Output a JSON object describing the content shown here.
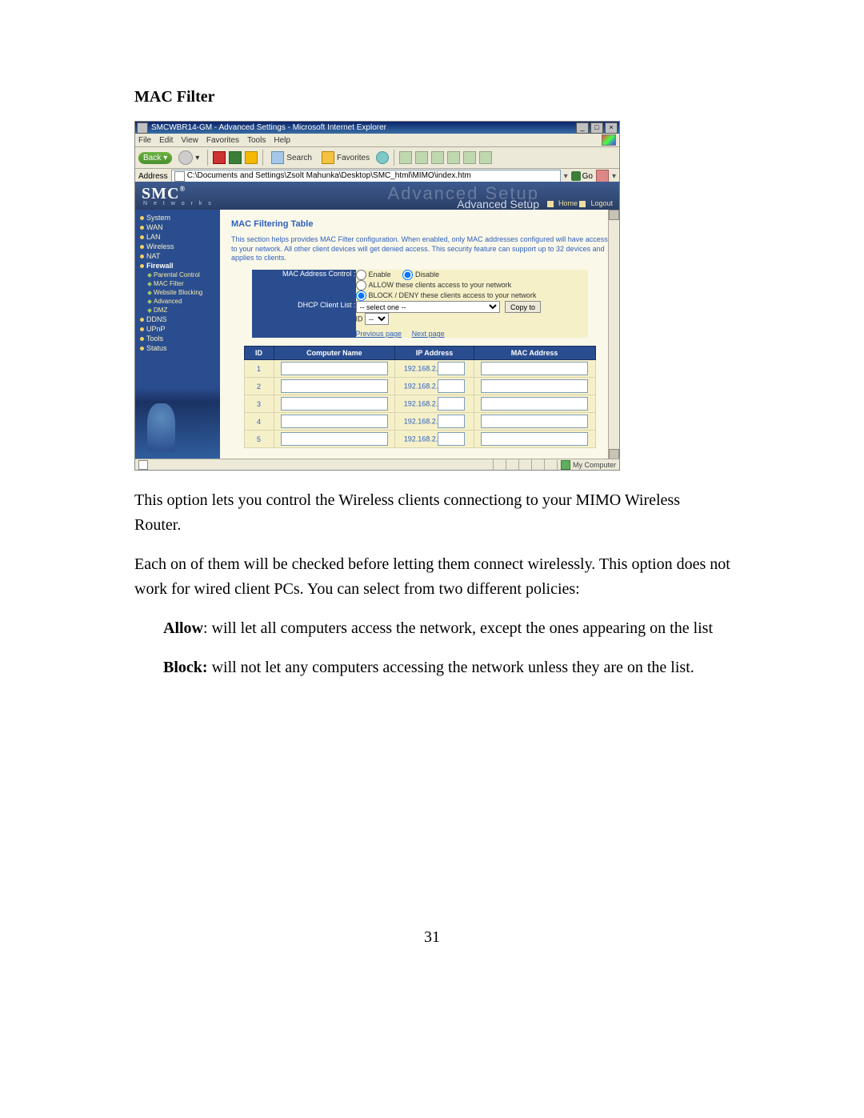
{
  "doc": {
    "heading": "MAC Filter",
    "p1": "This option lets you control the Wireless clients connectiong to your MIMO Wireless Router.",
    "p2": "Each on of them will be checked before letting them connect wirelessly. This option does not work for wired client PCs. You can select from two different policies:",
    "allow_label": "Allow",
    "allow_text": ": will let all computers access the network, except the ones appearing on the list",
    "block_label": "Block:",
    "block_text": " will not let any computers accessing the network unless they are on the list.",
    "page_number": "31"
  },
  "ie": {
    "title": "SMCWBR14-GM - Advanced Settings - Microsoft Internet Explorer",
    "menus": {
      "file": "File",
      "edit": "Edit",
      "view": "View",
      "favorites": "Favorites",
      "tools": "Tools",
      "help": "Help"
    },
    "toolbar": {
      "back": "Back",
      "search": "Search",
      "favorites": "Favorites"
    },
    "address_label": "Address",
    "address_value": "C:\\Documents and Settings\\Zsolt Mahunka\\Desktop\\SMC_html\\MIMO\\index.htm",
    "go": "Go",
    "status_zone": "My Computer"
  },
  "router": {
    "brand": "SMC",
    "brand_sub": "N e t w o r k s",
    "adv_bg": "Advanced Setup",
    "adv": "Advanced Setup",
    "home": "Home",
    "logout": "Logout",
    "nav": {
      "system": "System",
      "wan": "WAN",
      "lan": "LAN",
      "wireless": "Wireless",
      "nat": "NAT",
      "firewall": "Firewall",
      "parental": "Parental Control",
      "macfilter": "MAC Filter",
      "website": "Website Blocking",
      "advanced": "Advanced",
      "dmz": "DMZ",
      "ddns": "DDNS",
      "upnp": "UPnP",
      "tools": "Tools",
      "status": "Status"
    },
    "pane": {
      "title": "MAC Filtering Table",
      "desc": "This section helps provides MAC Filter configuration. When enabled, only MAC addresses configured will have access to your network. All other client devices will get denied access. This security feature can support up to 32 devices and applies to clients.",
      "mac_ctrl_label": "MAC Address Control :",
      "enable": "Enable",
      "disable": "Disable",
      "allow": "ALLOW these clients access to your network",
      "block": "BLOCK / DENY these clients access to your network",
      "dhcp_label": "DHCP Client List :",
      "dhcp_placeholder": "-- select one --",
      "copy": "Copy to",
      "id_label": "ID",
      "prev": "Previous page",
      "next": "Next page"
    },
    "table": {
      "h_id": "ID",
      "h_name": "Computer Name",
      "h_ip": "IP Address",
      "h_mac": "MAC Address",
      "ip_prefix": "192.168.2.",
      "rows": [
        {
          "id": "1"
        },
        {
          "id": "2"
        },
        {
          "id": "3"
        },
        {
          "id": "4"
        },
        {
          "id": "5"
        }
      ]
    }
  }
}
